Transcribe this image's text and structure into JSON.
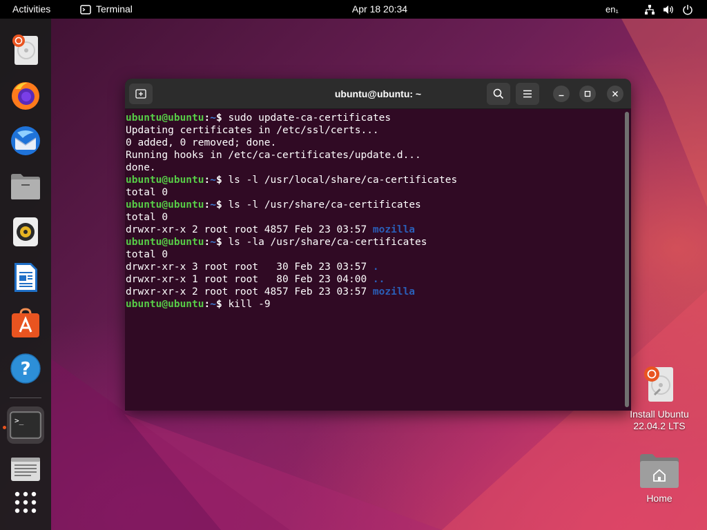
{
  "topbar": {
    "activities": "Activities",
    "app_name": "Terminal",
    "clock": "Apr 18  20:34",
    "lang": "en₁"
  },
  "dock": {
    "items": [
      {
        "name": "install-ubuntu"
      },
      {
        "name": "firefox"
      },
      {
        "name": "thunderbird"
      },
      {
        "name": "files"
      },
      {
        "name": "rhythmbox"
      },
      {
        "name": "libreoffice-writer"
      },
      {
        "name": "ubuntu-software"
      },
      {
        "name": "help"
      },
      {
        "name": "terminal"
      },
      {
        "name": "text-editor"
      },
      {
        "name": "show-apps"
      }
    ]
  },
  "terminal": {
    "title": "ubuntu@ubuntu: ~",
    "prompt": {
      "user": "ubuntu@ubuntu",
      "sep": ":",
      "path": "~",
      "sigil": "$ "
    },
    "lines": [
      {
        "kind": "cmd",
        "text": "sudo update-ca-certificates"
      },
      {
        "kind": "out",
        "text": "Updating certificates in /etc/ssl/certs..."
      },
      {
        "kind": "out",
        "text": "0 added, 0 removed; done."
      },
      {
        "kind": "out",
        "text": "Running hooks in /etc/ca-certificates/update.d..."
      },
      {
        "kind": "out",
        "text": "done."
      },
      {
        "kind": "cmd",
        "text": "ls -l /usr/local/share/ca-certificates"
      },
      {
        "kind": "out",
        "text": "total 0"
      },
      {
        "kind": "cmd",
        "text": "ls -l /usr/share/ca-certificates"
      },
      {
        "kind": "out",
        "text": "total 0"
      },
      {
        "kind": "ls",
        "text": "drwxr-xr-x 2 root root 4857 Feb 23 03:57 ",
        "dir": "mozilla"
      },
      {
        "kind": "cmd",
        "text": "ls -la /usr/share/ca-certificates"
      },
      {
        "kind": "out",
        "text": "total 0"
      },
      {
        "kind": "ls",
        "text": "drwxr-xr-x 3 root root   30 Feb 23 03:57 ",
        "dir": "."
      },
      {
        "kind": "ls",
        "text": "drwxr-xr-x 1 root root   80 Feb 23 04:00 ",
        "dir": ".."
      },
      {
        "kind": "ls",
        "text": "drwxr-xr-x 2 root root 4857 Feb 23 03:57 ",
        "dir": "mozilla"
      },
      {
        "kind": "cmd",
        "text": "kill -9"
      }
    ]
  },
  "desktop": {
    "install": {
      "line1": "Install Ubuntu",
      "line2": "22.04.2 LTS"
    },
    "home": {
      "label": "Home"
    }
  }
}
